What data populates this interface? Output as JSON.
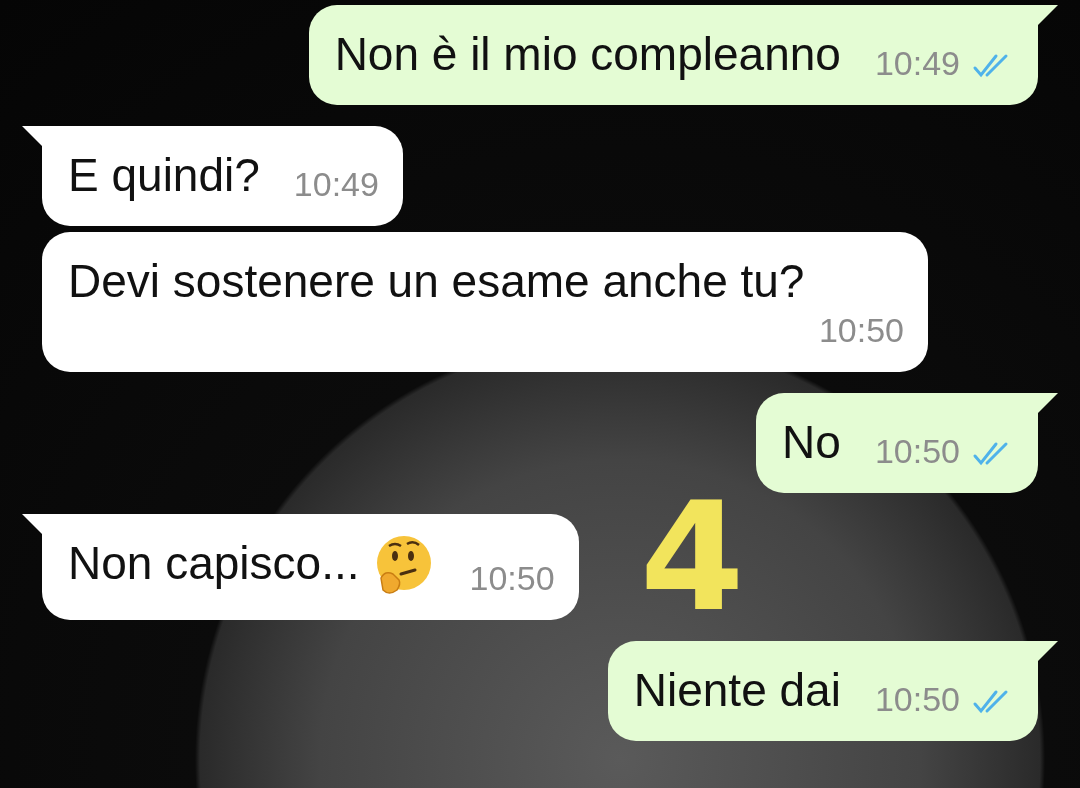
{
  "messages": [
    {
      "kind": "outgoing",
      "tail": true,
      "text": "Non è il mio compleanno",
      "time": "10:49",
      "read": true
    },
    {
      "kind": "incoming",
      "tail": true,
      "text": "E quindi?",
      "time": "10:49"
    },
    {
      "kind": "incoming",
      "tail": false,
      "text": "Devi sostenere un esame anche tu?",
      "time": "10:50"
    },
    {
      "kind": "outgoing",
      "tail": true,
      "text": "No",
      "time": "10:50",
      "read": true
    },
    {
      "kind": "incoming",
      "tail": true,
      "text": "Non capisco...",
      "time": "10:50",
      "emoji": true
    },
    {
      "kind": "outgoing",
      "tail": true,
      "text": "Niente dai",
      "time": "10:50",
      "read": true
    }
  ],
  "annotation": {
    "text": "4"
  }
}
